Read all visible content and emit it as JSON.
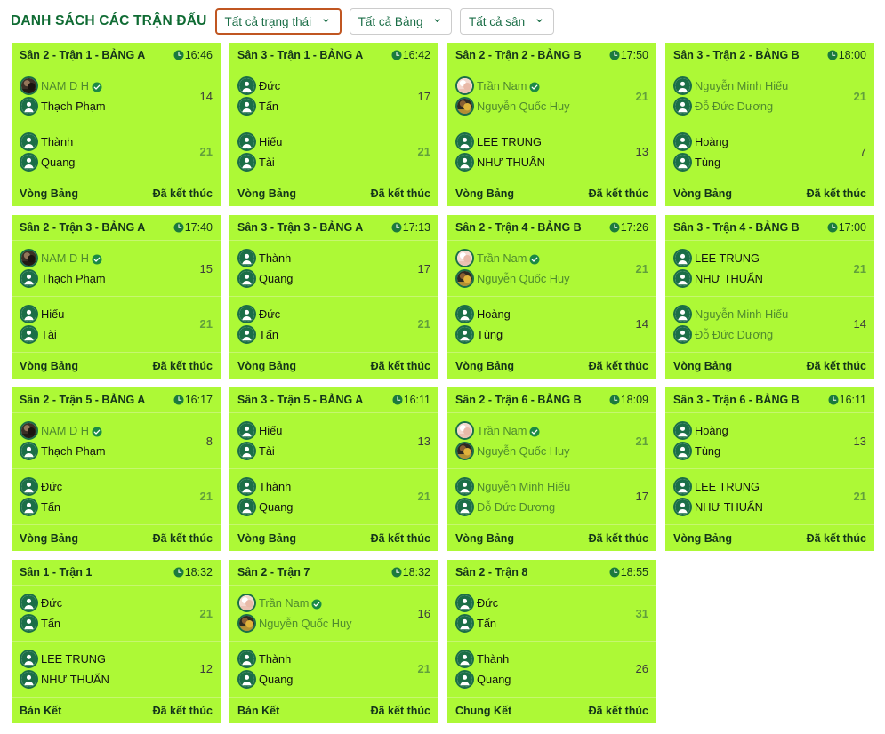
{
  "header": {
    "title": "DANH SÁCH CÁC TRẬN ĐẤU",
    "filters": [
      {
        "label": "Tất cả trạng thái",
        "caret": "chevron-down-icon",
        "focused": true
      },
      {
        "label": "Tất cả Bảng",
        "caret": "chevron-down-icon",
        "focused": false
      },
      {
        "label": "Tất cả sân",
        "caret": "chevron-down-icon",
        "focused": false
      }
    ]
  },
  "colors": {
    "card_bg": "#ADF936",
    "title_green": "#0f6b33",
    "score_win": "#62a03c",
    "score_lose": "#3c3c3c",
    "name_green": "#4f8a2e",
    "avatar_ring": "#1b6e47",
    "focus_border": "#c05621"
  },
  "matches": [
    {
      "title": "Sân 2 - Trận 1 - BẢNG A",
      "time": "16:46",
      "round": "Vòng Bảng",
      "status": "Đã kết thúc",
      "teams": [
        {
          "score": "14",
          "win": false,
          "players": [
            {
              "name": "NAM D H",
              "avatar": "photo-dark",
              "verified": true,
              "green": true
            },
            {
              "name": "Thạch Phạm",
              "avatar": "person-icon",
              "verified": false,
              "green": false
            }
          ]
        },
        {
          "score": "21",
          "win": true,
          "players": [
            {
              "name": "Thành",
              "avatar": "person-icon",
              "verified": false,
              "green": false
            },
            {
              "name": "Quang",
              "avatar": "person-icon",
              "verified": false,
              "green": false
            }
          ]
        }
      ]
    },
    {
      "title": "Sân 3 - Trận 1 - BẢNG A",
      "time": "16:42",
      "round": "Vòng Bảng",
      "status": "Đã kết thúc",
      "teams": [
        {
          "score": "17",
          "win": false,
          "players": [
            {
              "name": "Đức",
              "avatar": "person-icon",
              "verified": false,
              "green": false
            },
            {
              "name": "Tấn",
              "avatar": "person-icon",
              "verified": false,
              "green": false
            }
          ]
        },
        {
          "score": "21",
          "win": true,
          "players": [
            {
              "name": "Hiếu",
              "avatar": "person-icon",
              "verified": false,
              "green": false
            },
            {
              "name": "Tài",
              "avatar": "person-icon",
              "verified": false,
              "green": false
            }
          ]
        }
      ]
    },
    {
      "title": "Sân 2 - Trận 2 - BẢNG B",
      "time": "17:50",
      "round": "Vòng Bảng",
      "status": "Đã kết thúc",
      "teams": [
        {
          "score": "21",
          "win": true,
          "players": [
            {
              "name": "Trần Nam",
              "avatar": "photo-light",
              "verified": true,
              "green": true
            },
            {
              "name": "Nguyễn Quốc Huy",
              "avatar": "photo-yellow",
              "verified": false,
              "green": true
            }
          ]
        },
        {
          "score": "13",
          "win": false,
          "players": [
            {
              "name": "LEE TRUNG",
              "avatar": "person-icon",
              "verified": false,
              "green": false
            },
            {
              "name": "NHƯ THUẨN",
              "avatar": "person-icon",
              "verified": false,
              "green": false
            }
          ]
        }
      ]
    },
    {
      "title": "Sân 3 - Trận 2 - BẢNG B",
      "time": "18:00",
      "round": "Vòng Bảng",
      "status": "Đã kết thúc",
      "teams": [
        {
          "score": "21",
          "win": true,
          "players": [
            {
              "name": "Nguyễn Minh Hiếu",
              "avatar": "person-icon",
              "verified": false,
              "green": true
            },
            {
              "name": "Đỗ Đức Dương",
              "avatar": "person-icon",
              "verified": false,
              "green": true
            }
          ]
        },
        {
          "score": "7",
          "win": false,
          "players": [
            {
              "name": "Hoàng",
              "avatar": "person-icon",
              "verified": false,
              "green": false
            },
            {
              "name": "Tùng",
              "avatar": "person-icon",
              "verified": false,
              "green": false
            }
          ]
        }
      ]
    },
    {
      "title": "Sân 2 - Trận 3 - BẢNG A",
      "time": "17:40",
      "round": "Vòng Bảng",
      "status": "Đã kết thúc",
      "teams": [
        {
          "score": "15",
          "win": false,
          "players": [
            {
              "name": "NAM D H",
              "avatar": "photo-dark",
              "verified": true,
              "green": true
            },
            {
              "name": "Thạch Phạm",
              "avatar": "person-icon",
              "verified": false,
              "green": false
            }
          ]
        },
        {
          "score": "21",
          "win": true,
          "players": [
            {
              "name": "Hiếu",
              "avatar": "person-icon",
              "verified": false,
              "green": false
            },
            {
              "name": "Tài",
              "avatar": "person-icon",
              "verified": false,
              "green": false
            }
          ]
        }
      ]
    },
    {
      "title": "Sân 3 - Trận 3 - BẢNG A",
      "time": "17:13",
      "round": "Vòng Bảng",
      "status": "Đã kết thúc",
      "teams": [
        {
          "score": "17",
          "win": false,
          "players": [
            {
              "name": "Thành",
              "avatar": "person-icon",
              "verified": false,
              "green": false
            },
            {
              "name": "Quang",
              "avatar": "person-icon",
              "verified": false,
              "green": false
            }
          ]
        },
        {
          "score": "21",
          "win": true,
          "players": [
            {
              "name": "Đức",
              "avatar": "person-icon",
              "verified": false,
              "green": false
            },
            {
              "name": "Tấn",
              "avatar": "person-icon",
              "verified": false,
              "green": false
            }
          ]
        }
      ]
    },
    {
      "title": "Sân 2 - Trận 4 - BẢNG B",
      "time": "17:26",
      "round": "Vòng Bảng",
      "status": "Đã kết thúc",
      "teams": [
        {
          "score": "21",
          "win": true,
          "players": [
            {
              "name": "Trần Nam",
              "avatar": "photo-light",
              "verified": true,
              "green": true
            },
            {
              "name": "Nguyễn Quốc Huy",
              "avatar": "photo-yellow",
              "verified": false,
              "green": true
            }
          ]
        },
        {
          "score": "14",
          "win": false,
          "players": [
            {
              "name": "Hoàng",
              "avatar": "person-icon",
              "verified": false,
              "green": false
            },
            {
              "name": "Tùng",
              "avatar": "person-icon",
              "verified": false,
              "green": false
            }
          ]
        }
      ]
    },
    {
      "title": "Sân 3 - Trận 4 - BẢNG B",
      "time": "17:00",
      "round": "Vòng Bảng",
      "status": "Đã kết thúc",
      "teams": [
        {
          "score": "21",
          "win": true,
          "players": [
            {
              "name": "LEE TRUNG",
              "avatar": "person-icon",
              "verified": false,
              "green": false
            },
            {
              "name": "NHƯ THUẨN",
              "avatar": "person-icon",
              "verified": false,
              "green": false
            }
          ]
        },
        {
          "score": "14",
          "win": false,
          "players": [
            {
              "name": "Nguyễn Minh Hiếu",
              "avatar": "person-icon",
              "verified": false,
              "green": true
            },
            {
              "name": "Đỗ Đức Dương",
              "avatar": "person-icon",
              "verified": false,
              "green": true
            }
          ]
        }
      ]
    },
    {
      "title": "Sân 2 - Trận 5 - BẢNG A",
      "time": "16:17",
      "round": "Vòng Bảng",
      "status": "Đã kết thúc",
      "teams": [
        {
          "score": "8",
          "win": false,
          "players": [
            {
              "name": "NAM D H",
              "avatar": "photo-dark",
              "verified": true,
              "green": true
            },
            {
              "name": "Thạch Phạm",
              "avatar": "person-icon",
              "verified": false,
              "green": false
            }
          ]
        },
        {
          "score": "21",
          "win": true,
          "players": [
            {
              "name": "Đức",
              "avatar": "person-icon",
              "verified": false,
              "green": false
            },
            {
              "name": "Tấn",
              "avatar": "person-icon",
              "verified": false,
              "green": false
            }
          ]
        }
      ]
    },
    {
      "title": "Sân 3 - Trận 5 - BẢNG A",
      "time": "16:11",
      "round": "Vòng Bảng",
      "status": "Đã kết thúc",
      "teams": [
        {
          "score": "13",
          "win": false,
          "players": [
            {
              "name": "Hiếu",
              "avatar": "person-icon",
              "verified": false,
              "green": false
            },
            {
              "name": "Tài",
              "avatar": "person-icon",
              "verified": false,
              "green": false
            }
          ]
        },
        {
          "score": "21",
          "win": true,
          "players": [
            {
              "name": "Thành",
              "avatar": "person-icon",
              "verified": false,
              "green": false
            },
            {
              "name": "Quang",
              "avatar": "person-icon",
              "verified": false,
              "green": false
            }
          ]
        }
      ]
    },
    {
      "title": "Sân 2 - Trận 6 - BẢNG B",
      "time": "18:09",
      "round": "Vòng Bảng",
      "status": "Đã kết thúc",
      "teams": [
        {
          "score": "21",
          "win": true,
          "players": [
            {
              "name": "Trần Nam",
              "avatar": "photo-light",
              "verified": true,
              "green": true
            },
            {
              "name": "Nguyễn Quốc Huy",
              "avatar": "photo-yellow",
              "verified": false,
              "green": true
            }
          ]
        },
        {
          "score": "17",
          "win": false,
          "players": [
            {
              "name": "Nguyễn Minh Hiếu",
              "avatar": "person-icon",
              "verified": false,
              "green": true
            },
            {
              "name": "Đỗ Đức Dương",
              "avatar": "person-icon",
              "verified": false,
              "green": true
            }
          ]
        }
      ]
    },
    {
      "title": "Sân 3 - Trận 6 - BẢNG B",
      "time": "16:11",
      "round": "Vòng Bảng",
      "status": "Đã kết thúc",
      "teams": [
        {
          "score": "13",
          "win": false,
          "players": [
            {
              "name": "Hoàng",
              "avatar": "person-icon",
              "verified": false,
              "green": false
            },
            {
              "name": "Tùng",
              "avatar": "person-icon",
              "verified": false,
              "green": false
            }
          ]
        },
        {
          "score": "21",
          "win": true,
          "players": [
            {
              "name": "LEE TRUNG",
              "avatar": "person-icon",
              "verified": false,
              "green": false
            },
            {
              "name": "NHƯ THUẨN",
              "avatar": "person-icon",
              "verified": false,
              "green": false
            }
          ]
        }
      ]
    },
    {
      "title": "Sân 1 - Trận 1",
      "time": "18:32",
      "round": "Bán Kết",
      "status": "Đã kết thúc",
      "teams": [
        {
          "score": "21",
          "win": true,
          "players": [
            {
              "name": "Đức",
              "avatar": "person-icon",
              "verified": false,
              "green": false
            },
            {
              "name": "Tấn",
              "avatar": "person-icon",
              "verified": false,
              "green": false
            }
          ]
        },
        {
          "score": "12",
          "win": false,
          "players": [
            {
              "name": "LEE TRUNG",
              "avatar": "person-icon",
              "verified": false,
              "green": false
            },
            {
              "name": "NHƯ THUẨN",
              "avatar": "person-icon",
              "verified": false,
              "green": false
            }
          ]
        }
      ]
    },
    {
      "title": "Sân 2 - Trận 7",
      "time": "18:32",
      "round": "Bán Kết",
      "status": "Đã kết thúc",
      "teams": [
        {
          "score": "16",
          "win": false,
          "players": [
            {
              "name": "Trần Nam",
              "avatar": "photo-light",
              "verified": true,
              "green": true
            },
            {
              "name": "Nguyễn Quốc Huy",
              "avatar": "photo-yellow",
              "verified": false,
              "green": true
            }
          ]
        },
        {
          "score": "21",
          "win": true,
          "players": [
            {
              "name": "Thành",
              "avatar": "person-icon",
              "verified": false,
              "green": false
            },
            {
              "name": "Quang",
              "avatar": "person-icon",
              "verified": false,
              "green": false
            }
          ]
        }
      ]
    },
    {
      "title": "Sân 2 - Trận 8",
      "time": "18:55",
      "round": "Chung Kết",
      "status": "Đã kết thúc",
      "teams": [
        {
          "score": "31",
          "win": true,
          "players": [
            {
              "name": "Đức",
              "avatar": "person-icon",
              "verified": false,
              "green": false
            },
            {
              "name": "Tấn",
              "avatar": "person-icon",
              "verified": false,
              "green": false
            }
          ]
        },
        {
          "score": "26",
          "win": false,
          "players": [
            {
              "name": "Thành",
              "avatar": "person-icon",
              "verified": false,
              "green": false
            },
            {
              "name": "Quang",
              "avatar": "person-icon",
              "verified": false,
              "green": false
            }
          ]
        }
      ]
    }
  ]
}
